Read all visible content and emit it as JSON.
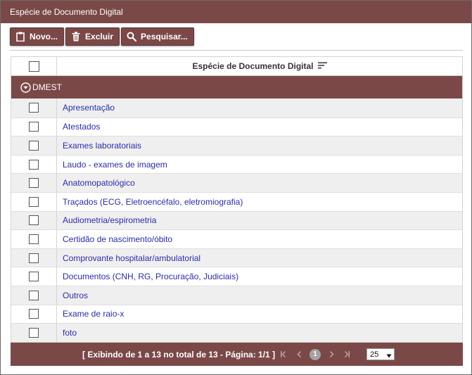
{
  "title": "Espécie de Documento Digital",
  "toolbar": {
    "novo": "Novo...",
    "excluir": "Excluir",
    "pesquisar": "Pesquisar..."
  },
  "grid": {
    "column_header": "Espécie de Documento Digital",
    "group_label": "DMEST",
    "rows": [
      "Apresentação",
      "Atestados",
      "Exames laboratoriais",
      "Laudo - exames de imagem",
      "Anatomopatológico",
      "Traçados (ECG, Eletroencéfalo, eletromiografia)",
      "Audiometria/espirometria",
      "Certidão de nascimento/óbito",
      "Comprovante hospitalar/ambulatorial",
      "Documentos (CNH, RG, Procuração, Judiciais)",
      "Outros",
      "Exame de raio-x",
      "foto"
    ]
  },
  "footer": {
    "info": "[ Exibindo de 1 a 13 no total de 13 - Página: 1/1 ]",
    "current_page": "1",
    "page_size": "25"
  },
  "icons": {
    "novo": "clipboard-icon",
    "excluir": "trash-icon",
    "pesquisar": "search-icon",
    "sort": "sort-icon",
    "group": "chevron-down-circle-icon"
  },
  "colors": {
    "accent": "#7b4848",
    "link": "#2b2bb0"
  }
}
